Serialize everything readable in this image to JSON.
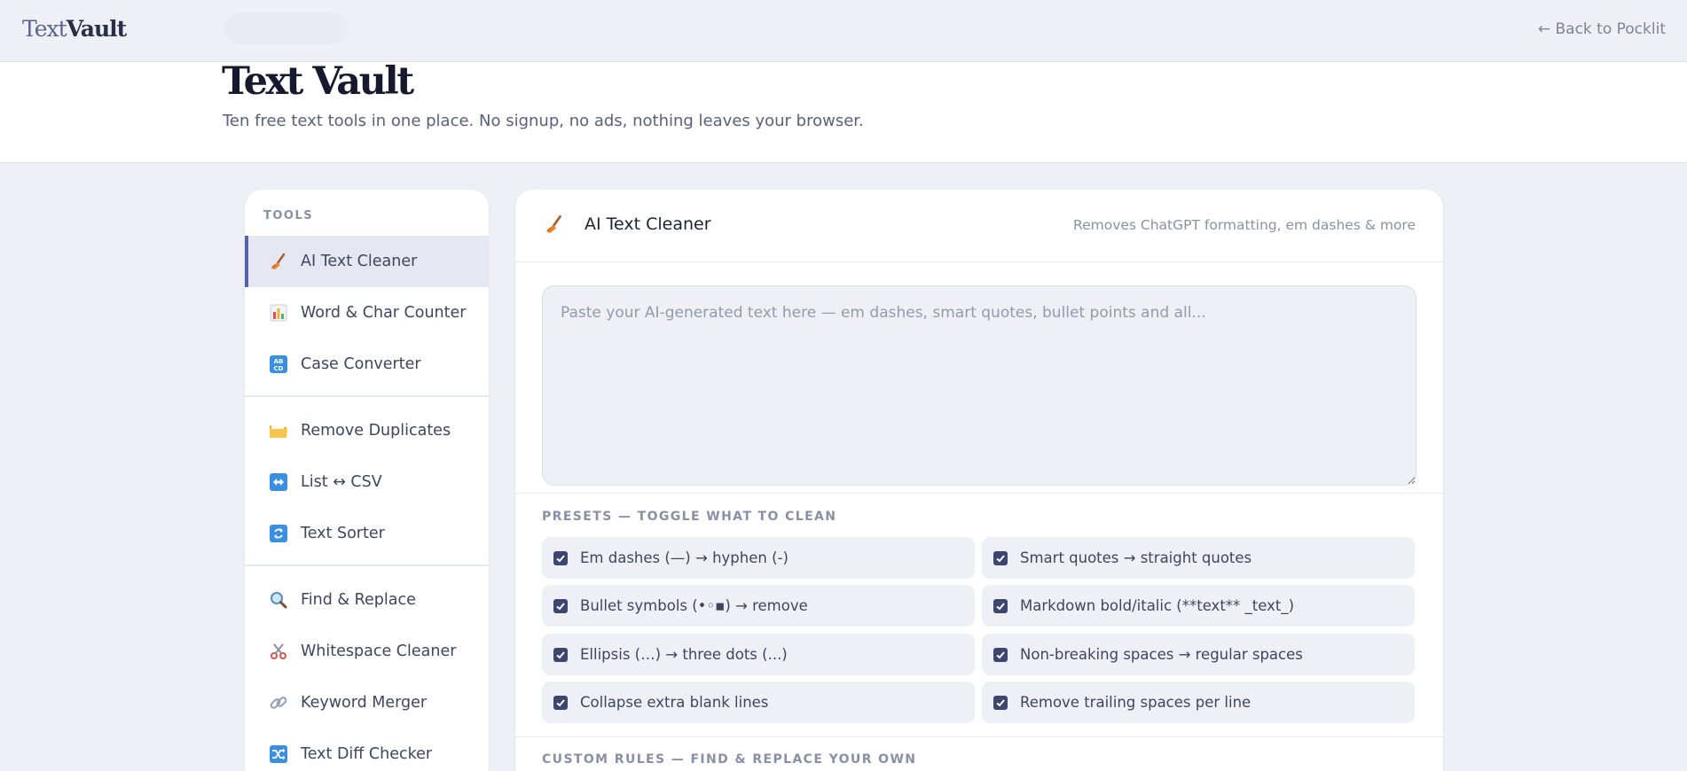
{
  "app": {
    "logo_light": "Text",
    "logo_bold": "Vault",
    "back_link": "← Back to Pocklit"
  },
  "hero": {
    "title": "Text Vault",
    "subtitle": "Ten free text tools in one place. No signup, no ads, nothing leaves your browser."
  },
  "sidebar": {
    "heading": "TOOLS",
    "items": [
      {
        "label": "AI Text Cleaner",
        "icon": "broom-icon",
        "active": true
      },
      {
        "label": "Word & Char Counter",
        "icon": "bar-chart-icon"
      },
      {
        "label": "Case Converter",
        "icon": "abcd-icon"
      },
      {
        "label": "Remove Duplicates",
        "icon": "folder-icon"
      },
      {
        "label": "List ↔ CSV",
        "icon": "left-right-arrow-icon"
      },
      {
        "label": "Text Sorter",
        "icon": "repeat-icon"
      },
      {
        "label": "Find & Replace",
        "icon": "magnifier-icon"
      },
      {
        "label": "Whitespace Cleaner",
        "icon": "scissors-icon"
      },
      {
        "label": "Keyword Merger",
        "icon": "link-icon"
      },
      {
        "label": "Text Diff Checker",
        "icon": "shuffle-icon"
      }
    ]
  },
  "tool": {
    "icon": "broom-icon",
    "title": "AI Text Cleaner",
    "description": "Removes ChatGPT formatting, em dashes & more",
    "input_placeholder": "Paste your AI-generated text here — em dashes, smart quotes, bullet points and all...",
    "input_value": "",
    "presets_heading": "PRESETS — TOGGLE WHAT TO CLEAN",
    "presets": [
      {
        "label": "Em dashes (—) → hyphen (-)",
        "checked": true
      },
      {
        "label": "Smart quotes → straight quotes",
        "checked": true
      },
      {
        "label": "Bullet symbols (•◦▪) → remove",
        "checked": true
      },
      {
        "label": "Markdown bold/italic (**text** _text_)",
        "checked": true
      },
      {
        "label": "Ellipsis (…) → three dots (...)",
        "checked": true
      },
      {
        "label": "Non-breaking spaces → regular spaces",
        "checked": true
      },
      {
        "label": "Collapse extra blank lines",
        "checked": true
      },
      {
        "label": "Remove trailing spaces per line",
        "checked": true
      }
    ],
    "custom_heading": "CUSTOM RULES — FIND & REPLACE YOUR OWN"
  },
  "colors": {
    "accent": "#5563a7",
    "checkbox": "#3d4670",
    "page_bg": "#eef0f5"
  }
}
